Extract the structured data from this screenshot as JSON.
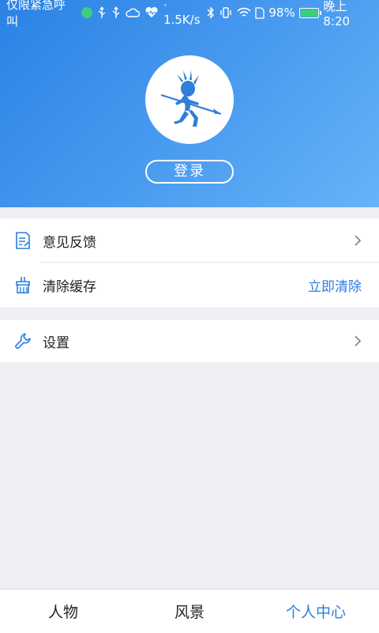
{
  "statusbar": {
    "carrier": "仅限紧急呼叫",
    "speed": "· 1.5K/s",
    "battery": "98%",
    "time": "晚上8:20"
  },
  "profile": {
    "avatar_icon": "kokopelli-logo-icon",
    "login_label": "登录"
  },
  "menu": {
    "feedback": {
      "label": "意见反馈",
      "icon": "feedback-icon"
    },
    "clear_cache": {
      "label": "清除缓存",
      "action": "立即清除",
      "icon": "broom-icon"
    },
    "settings": {
      "label": "设置",
      "icon": "wrench-icon"
    }
  },
  "tabs": [
    {
      "label": "人物"
    },
    {
      "label": "风景"
    },
    {
      "label": "个人中心"
    }
  ],
  "colors": {
    "accent": "#2a7de0",
    "header_start": "#2b82e4",
    "header_end": "#67b3f8",
    "background": "#efeff4"
  }
}
